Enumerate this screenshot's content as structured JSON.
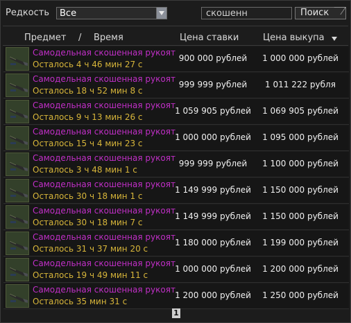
{
  "filter": {
    "label": "Редкость",
    "selected": "Все"
  },
  "search": {
    "value": "скошенн",
    "button_label": "Поиск"
  },
  "columns": {
    "item": "Предмет",
    "separator": "/",
    "time": "Время",
    "bid": "Цена ставки",
    "buyout": "Цена выкупа"
  },
  "rows": [
    {
      "name": "Самодельная скошенная рукоят..",
      "time": "Осталось 4 ч 46 мин 27 с",
      "bid": "900 000 рублей",
      "buyout": "1 000 000 рублей"
    },
    {
      "name": "Самодельная скошенная рукоят..",
      "time": "Осталось 18 ч 52 мин 8 с",
      "bid": "999 999 рублей",
      "buyout": "1 011 222 рубля"
    },
    {
      "name": "Самодельная скошенная рукоят..",
      "time": "Осталось 9 ч 13 мин 26 с",
      "bid": "1 059 905 рублей",
      "buyout": "1 069 905 рублей"
    },
    {
      "name": "Самодельная скошенная рукоят..",
      "time": "Осталось 15 ч 4 мин 23 с",
      "bid": "1 000 000 рублей",
      "buyout": "1 095 000 рублей"
    },
    {
      "name": "Самодельная скошенная рукоят..",
      "time": "Осталось 3 ч 48 мин 1 с",
      "bid": "999 999 рублей",
      "buyout": "1 100 000 рублей"
    },
    {
      "name": "Самодельная скошенная рукоят..",
      "time": "Осталось 30 ч 18 мин 1 с",
      "bid": "1 149 999 рублей",
      "buyout": "1 150 000 рублей"
    },
    {
      "name": "Самодельная скошенная рукоят..",
      "time": "Осталось 30 ч 18 мин 7 с",
      "bid": "1 149 999 рублей",
      "buyout": "1 150 000 рублей"
    },
    {
      "name": "Самодельная скошенная рукоят..",
      "time": "Осталось 31 ч 37 мин 20 с",
      "bid": "1 180 000 рублей",
      "buyout": "1 199 000 рублей"
    },
    {
      "name": "Самодельная скошенная рукоят..",
      "time": "Осталось 19 ч 49 мин 11 с",
      "bid": "1 000 000 рублей",
      "buyout": "1 200 000 рублей"
    },
    {
      "name": "Самодельная скошенная рукоят..",
      "time": "Осталось 35 мин 31 с",
      "bid": "1 200 000 рублей",
      "buyout": "1 250 000 рублей"
    }
  ],
  "pagination": {
    "current_page": "1"
  },
  "colors": {
    "item_name": "#c12fc7",
    "time_left": "#d7b53a",
    "price": "#f0f0f0"
  },
  "icons": {
    "item_thumbnail": "handle-icon",
    "sort_indicator": "sort-desc-arrow-icon"
  }
}
